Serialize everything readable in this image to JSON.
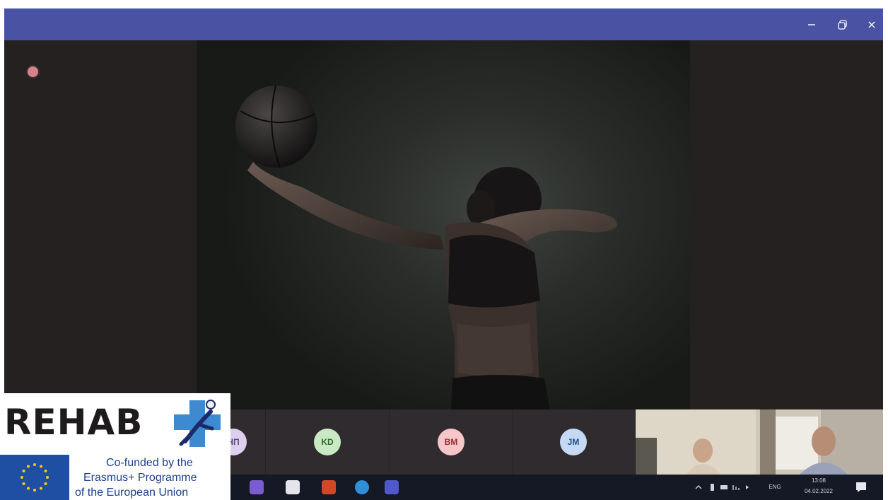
{
  "window": {
    "controls": {
      "minimize_icon": "minimize-icon",
      "maximize_icon": "maximize-icon",
      "close_icon": "close-icon"
    }
  },
  "participants": [
    {
      "initials": "НП",
      "bg": "#ddd0ee",
      "fg": "#5a4a82"
    },
    {
      "initials": "KD",
      "bg": "#c9e9c4",
      "fg": "#2f6a2f"
    },
    {
      "initials": "BM",
      "bg": "#f6c6c8",
      "fg": "#9c2b34"
    },
    {
      "initials": "JM",
      "bg": "#c6d9f2",
      "fg": "#1f4f8c"
    }
  ],
  "taskbar": {
    "tray": {
      "language": "ENG",
      "time": "13:08",
      "date": "04.02.2022"
    }
  },
  "logo": {
    "title": "REHAB",
    "line1": "Co-funded by the",
    "line2": "Erasmus+ Programme",
    "line3": "of the European Union"
  },
  "colors": {
    "titlebar": "#4a52a3",
    "stage": "#252121",
    "recording_dot": "#d9818a",
    "logo_text_blue": "#1e3f90",
    "eu_blue": "#1e4fa3",
    "eu_star": "#ffcc00"
  }
}
